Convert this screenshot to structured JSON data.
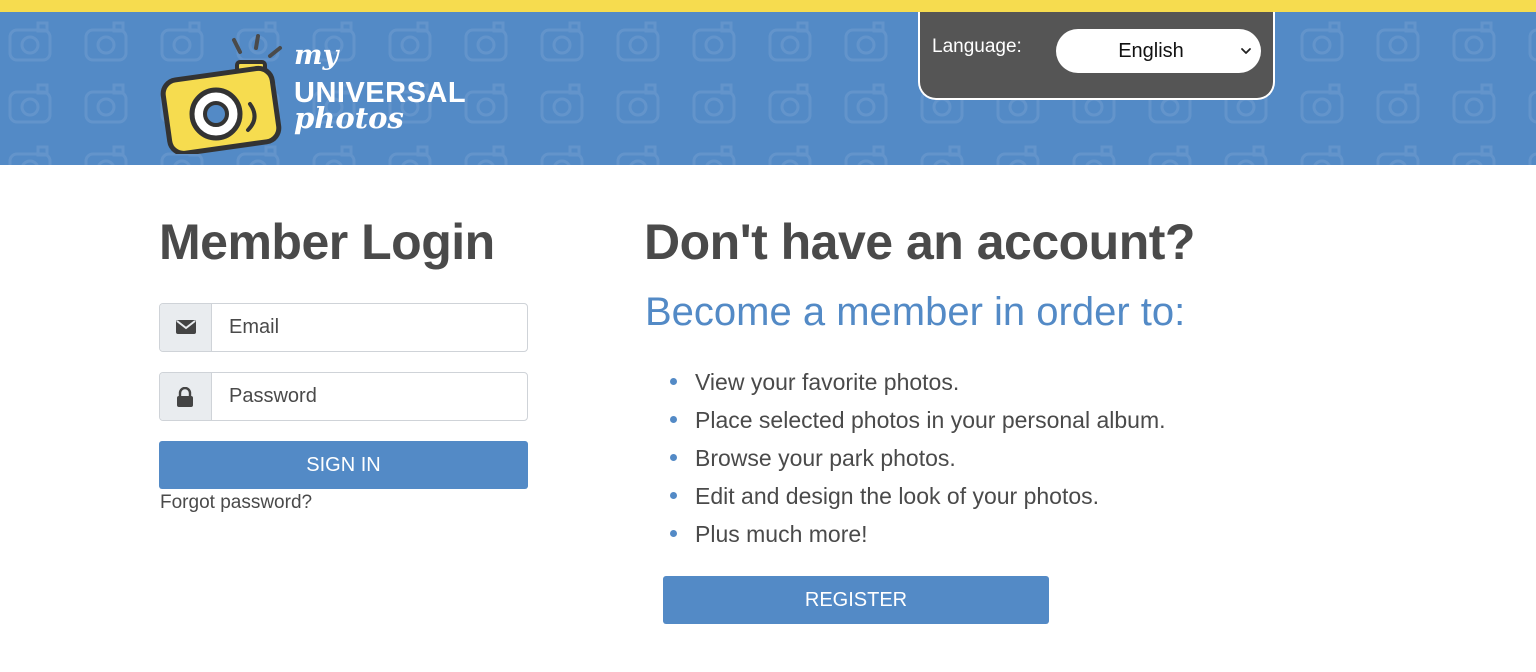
{
  "brand": {
    "logo_line1": "my",
    "logo_line2": "UNIVERSAL",
    "logo_line3": "photos",
    "stripe_color": "#f6dc4f",
    "header_color": "#538ac6",
    "accent_color": "#538ac6"
  },
  "language": {
    "label": "Language:",
    "selected": "English",
    "panel_color": "#555555"
  },
  "login": {
    "title": "Member Login",
    "email_placeholder": "Email",
    "email_icon": "envelope-icon",
    "password_placeholder": "Password",
    "password_icon": "lock-icon",
    "sign_in_label": "SIGN IN",
    "forgot_label": "Forgot password?"
  },
  "register": {
    "title": "Don't have an account?",
    "subtitle": "Become a member in order to:",
    "benefits": [
      "View your favorite photos.",
      "Place selected photos in your personal album.",
      "Browse your park photos.",
      "Edit and design the look of your photos.",
      "Plus much more!"
    ],
    "register_label": "REGISTER"
  }
}
